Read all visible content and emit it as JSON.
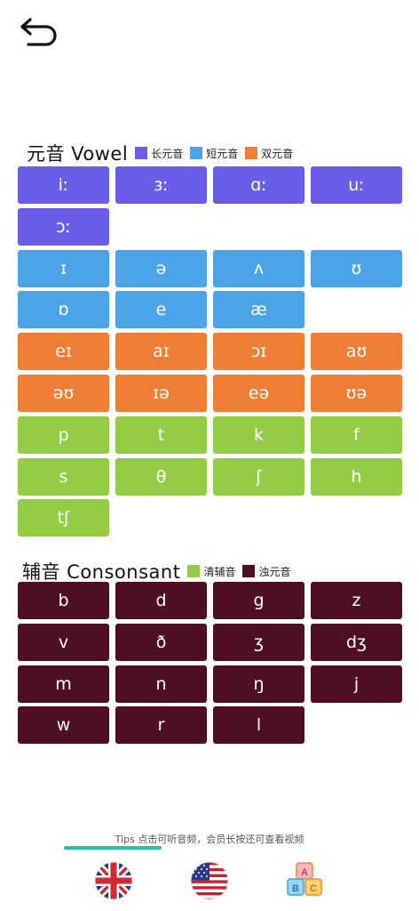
{
  "colors": {
    "long_vowel": "#6a5ee8",
    "short_vowel": "#4ca3e6",
    "diphthong": "#ee7d35",
    "voiceless": "#94cc45",
    "voiced": "#4e0f24"
  },
  "vowel_section": {
    "title": "元音 Vowel",
    "legend": [
      {
        "label": "长元音",
        "color": "#6a5ee8"
      },
      {
        "label": "短元音",
        "color": "#4ca3e6"
      },
      {
        "label": "双元音",
        "color": "#ee7d35"
      }
    ],
    "symbols": [
      {
        "s": "iː",
        "c": "#6a5ee8"
      },
      {
        "s": "ɜː",
        "c": "#6a5ee8"
      },
      {
        "s": "ɑː",
        "c": "#6a5ee8"
      },
      {
        "s": "uː",
        "c": "#6a5ee8"
      },
      {
        "s": "ɔː",
        "c": "#6a5ee8"
      },
      {
        "s": "ɪ",
        "c": "#4ca3e6"
      },
      {
        "s": "ə",
        "c": "#4ca3e6"
      },
      {
        "s": "ʌ",
        "c": "#4ca3e6"
      },
      {
        "s": "ʊ",
        "c": "#4ca3e6"
      },
      {
        "s": "ɒ",
        "c": "#4ca3e6"
      },
      {
        "s": "e",
        "c": "#4ca3e6"
      },
      {
        "s": "æ",
        "c": "#4ca3e6"
      },
      {
        "s": "eɪ",
        "c": "#ee7d35"
      },
      {
        "s": "aɪ",
        "c": "#ee7d35"
      },
      {
        "s": "ɔɪ",
        "c": "#ee7d35"
      },
      {
        "s": "aʊ",
        "c": "#ee7d35"
      },
      {
        "s": "əʊ",
        "c": "#ee7d35"
      },
      {
        "s": "ɪə",
        "c": "#ee7d35"
      },
      {
        "s": "eə",
        "c": "#ee7d35"
      },
      {
        "s": "ʊə",
        "c": "#ee7d35"
      },
      {
        "s": "p",
        "c": "#94cc45"
      },
      {
        "s": "t",
        "c": "#94cc45"
      },
      {
        "s": "k",
        "c": "#94cc45"
      },
      {
        "s": "f",
        "c": "#94cc45"
      },
      {
        "s": "s",
        "c": "#94cc45"
      },
      {
        "s": "θ",
        "c": "#94cc45"
      },
      {
        "s": "ʃ",
        "c": "#94cc45"
      },
      {
        "s": "h",
        "c": "#94cc45"
      },
      {
        "s": "tʃ",
        "c": "#94cc45"
      }
    ]
  },
  "consonant_section": {
    "title": "辅音 Consonsant",
    "legend": [
      {
        "label": "清辅音",
        "color": "#94cc45"
      },
      {
        "label": "浊元音",
        "color": "#4e0f24"
      }
    ],
    "symbols": [
      {
        "s": "b",
        "c": "#4e0f24"
      },
      {
        "s": "d",
        "c": "#4e0f24"
      },
      {
        "s": "g",
        "c": "#4e0f24"
      },
      {
        "s": "z",
        "c": "#4e0f24"
      },
      {
        "s": "v",
        "c": "#4e0f24"
      },
      {
        "s": "ð",
        "c": "#4e0f24"
      },
      {
        "s": "ʒ",
        "c": "#4e0f24"
      },
      {
        "s": "dʒ",
        "c": "#4e0f24"
      },
      {
        "s": "m",
        "c": "#4e0f24"
      },
      {
        "s": "n",
        "c": "#4e0f24"
      },
      {
        "s": "ŋ",
        "c": "#4e0f24"
      },
      {
        "s": "j",
        "c": "#4e0f24"
      },
      {
        "s": "w",
        "c": "#4e0f24"
      },
      {
        "s": "r",
        "c": "#4e0f24"
      },
      {
        "s": "l",
        "c": "#4e0f24"
      }
    ]
  },
  "tips": "Tips 点击可听音频，会员长按还可查看视频",
  "bottom_bar": {
    "icons": [
      "uk-flag-icon",
      "us-flag-icon",
      "abc-blocks-icon"
    ],
    "block_letters": [
      "A",
      "B",
      "C"
    ]
  }
}
